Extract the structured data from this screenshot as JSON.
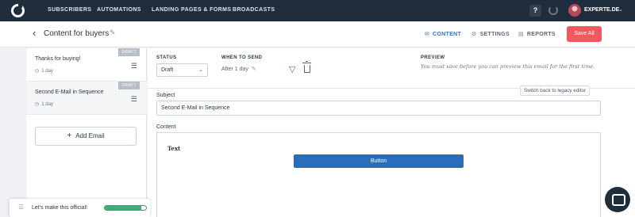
{
  "nav": {
    "items": [
      "SUBSCRIBERS",
      "AUTOMATIONS",
      "LANDING PAGES & FORMS",
      "BROADCASTS"
    ],
    "help_label": "?",
    "account_name": "EXPERTE.DE"
  },
  "header": {
    "title": "Content for buyers",
    "tabs": [
      "CONTENT",
      "SETTINGS",
      "REPORTS"
    ],
    "active_tab": "CONTENT",
    "save_label": "Save All"
  },
  "sidebar": {
    "emails": [
      {
        "name": "Thanks for buying!",
        "delay": "1 day",
        "badge": "DRAFT"
      },
      {
        "name": "Second E-Mail in Sequence",
        "delay": "1 day",
        "badge": "DRAFT"
      }
    ],
    "add_label": "Add Email"
  },
  "editor": {
    "status_label": "STATUS",
    "status_value": "Draft",
    "when_label": "WHEN TO SEND",
    "when_value": "After 1 day",
    "preview_label": "PREVIEW",
    "preview_message": "You must save before you can preview this email for the first time.",
    "legacy_label": "Switch back to legacy editor",
    "subject_label": "Subject",
    "subject_value": "Second E-Mail in Sequence",
    "content_label": "Content",
    "body_text": "Text",
    "body_button": "Button"
  },
  "toast": {
    "message": "Let's make this official!",
    "progress": 0.88,
    "progress_color": "#38b077"
  },
  "colors": {
    "nav_bg": "#1f2d3d",
    "accent": "#3b6eb5",
    "save": "#f1595e",
    "editor_button": "#2a6ebb"
  }
}
